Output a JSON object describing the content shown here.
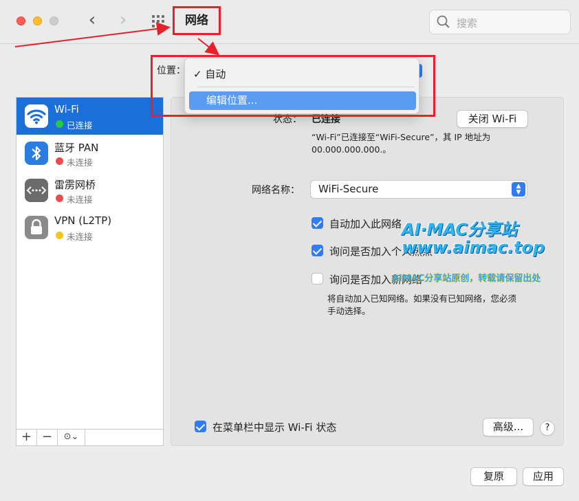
{
  "window": {
    "title": "网络"
  },
  "search": {
    "placeholder": "搜索"
  },
  "location": {
    "label": "位置：",
    "menu": {
      "checked_item": "✓ 自动",
      "highlighted_item": "编辑位置..."
    }
  },
  "sidebar": {
    "items": [
      {
        "name": "Wi-Fi",
        "status": "已连接",
        "status_color": "#28c840",
        "icon": "wifi-icon",
        "selected": true
      },
      {
        "name": "蓝牙 PAN",
        "status": "未连接",
        "status_color": "#ee4b4b",
        "icon": "bluetooth-icon",
        "selected": false
      },
      {
        "name": "雷雳网桥",
        "status": "未连接",
        "status_color": "#ee4b4b",
        "icon": "thunderbolt-bridge-icon",
        "selected": false
      },
      {
        "name": "VPN (L2TP)",
        "status": "未连接",
        "status_color": "#f5c518",
        "icon": "lock-icon",
        "selected": false
      }
    ],
    "toolbar": {
      "add": "+",
      "remove": "−",
      "action": "⊙⌄"
    }
  },
  "detail": {
    "status_label": "状态：",
    "status_value": "已连接",
    "turn_off_button": "关闭 Wi-Fi",
    "status_desc_line1": "“Wi-Fi”已连接至“WiFi-Secure”，其 IP 地址为",
    "status_desc_line2": "00.000.000.000.。",
    "network_name_label": "网络名称：",
    "network_name_value": "WiFi-Secure",
    "auto_join": {
      "label": "自动加入此网络",
      "checked": true
    },
    "ask_join_hotspot": {
      "label": "询问是否加入个人热点",
      "checked": true
    },
    "ask_join_new": {
      "label": "询问是否加入新网络",
      "checked": false
    },
    "ask_join_desc_line1": "将自动加入已知网络。如果没有已知网络，您必须",
    "ask_join_desc_line2": "手动选择。",
    "show_in_menubar": {
      "label": "在菜单栏中显示 Wi-Fi 状态",
      "checked": true
    },
    "advanced_button": "高级...",
    "help_button": "?"
  },
  "footer": {
    "revert_button": "复原",
    "apply_button": "应用"
  },
  "watermark": {
    "line1": "AI·MAC分享站",
    "line2": "www.aimac.top",
    "line3": "AIMAC分享站原创，转载请保留出处"
  },
  "colors": {
    "accent": "#2f7cf6",
    "selection": "#1b6fd8",
    "annotation_red": "#e8202a"
  }
}
